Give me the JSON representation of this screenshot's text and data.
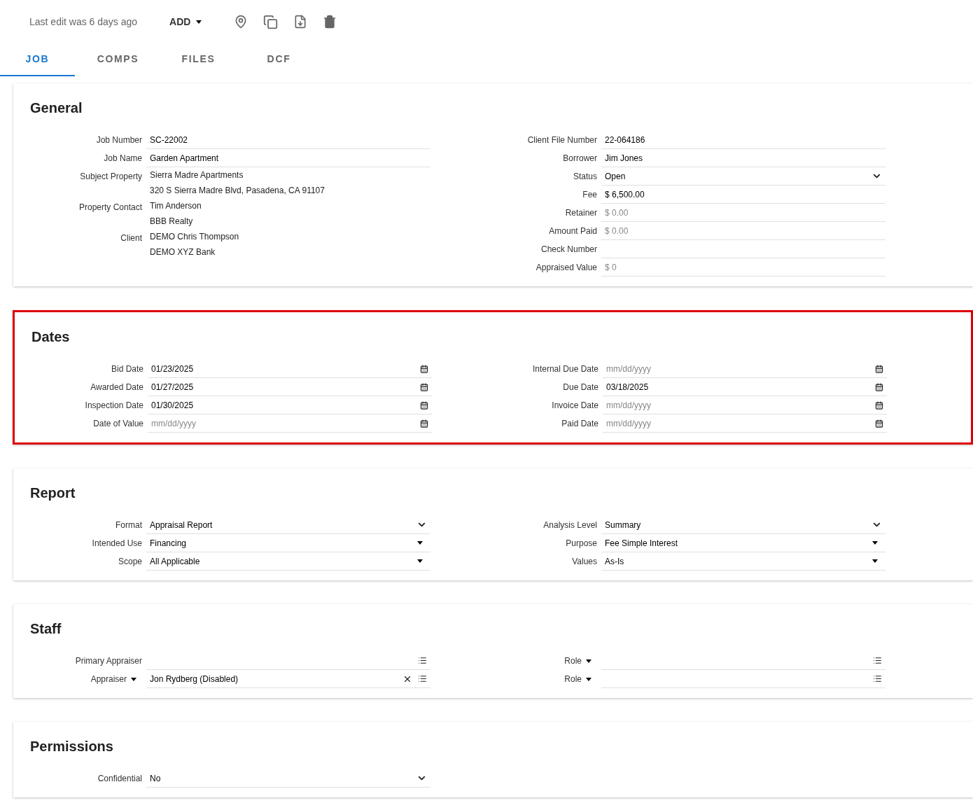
{
  "toolbar": {
    "last_edit": "Last edit was 6 days ago",
    "add_button": "ADD"
  },
  "tabs": [
    {
      "label": "JOB",
      "selected": true
    },
    {
      "label": "COMPS",
      "selected": false
    },
    {
      "label": "FILES",
      "selected": false
    },
    {
      "label": "DCF",
      "selected": false
    }
  ],
  "sections": [
    {
      "title": "General",
      "highlighted": false,
      "left": [
        {
          "label": "Job Number",
          "kind": "text",
          "value": "SC-22002"
        },
        {
          "label": "Job Name",
          "kind": "text",
          "value": "Garden Apartment"
        },
        {
          "label": "Subject Property",
          "kind": "plain",
          "lines": [
            "Sierra Madre Apartments",
            "320 S Sierra Madre Blvd, Pasadena, CA 91107"
          ]
        },
        {
          "label": "Property Contact",
          "kind": "plain",
          "lines": [
            "Tim Anderson",
            "BBB Realty"
          ]
        },
        {
          "label": "Client",
          "kind": "plain",
          "lines": [
            "DEMO Chris Thompson",
            "DEMO XYZ Bank"
          ]
        }
      ],
      "right": [
        {
          "label": "Client File Number",
          "kind": "text",
          "value": "22-064186"
        },
        {
          "label": "Borrower",
          "kind": "text",
          "value": "Jim Jones"
        },
        {
          "label": "Status",
          "kind": "select",
          "value": "Open"
        },
        {
          "label": "Fee",
          "kind": "text",
          "value": "$ 6,500.00"
        },
        {
          "label": "Retainer",
          "kind": "text",
          "placeholder": "$ 0.00"
        },
        {
          "label": "Amount Paid",
          "kind": "text",
          "placeholder": "$ 0.00"
        },
        {
          "label": "Check Number",
          "kind": "text"
        },
        {
          "label": "Appraised Value",
          "kind": "text",
          "placeholder": "$ 0"
        }
      ]
    },
    {
      "title": "Dates",
      "highlighted": true,
      "left": [
        {
          "label": "Bid Date",
          "kind": "date",
          "value": "01/23/2025"
        },
        {
          "label": "Awarded Date",
          "kind": "date",
          "value": "01/27/2025"
        },
        {
          "label": "Inspection Date",
          "kind": "date",
          "value": "01/30/2025"
        },
        {
          "label": "Date of Value",
          "kind": "date",
          "placeholder": "mm/dd/yyyy"
        }
      ],
      "right": [
        {
          "label": "Internal Due Date",
          "kind": "date",
          "placeholder": "mm/dd/yyyy"
        },
        {
          "label": "Due Date",
          "kind": "date",
          "value": "03/18/2025"
        },
        {
          "label": "Invoice Date",
          "kind": "date",
          "placeholder": "mm/dd/yyyy"
        },
        {
          "label": "Paid Date",
          "kind": "date",
          "placeholder": "mm/dd/yyyy"
        }
      ]
    },
    {
      "title": "Report",
      "highlighted": false,
      "left": [
        {
          "label": "Format",
          "kind": "select",
          "value": "Appraisal Report"
        },
        {
          "label": "Intended Use",
          "kind": "dropdown",
          "value": "Financing"
        },
        {
          "label": "Scope",
          "kind": "dropdown",
          "value": "All Applicable"
        }
      ],
      "right": [
        {
          "label": "Analysis Level",
          "kind": "select",
          "value": "Summary"
        },
        {
          "label": "Purpose",
          "kind": "dropdown",
          "value": "Fee Simple Interest"
        },
        {
          "label": "Values",
          "kind": "dropdown",
          "value": "As-Is"
        }
      ]
    },
    {
      "title": "Staff",
      "highlighted": false,
      "left": [
        {
          "label": "Primary Appraiser",
          "kind": "picker",
          "label_menu": false,
          "clearable": false
        },
        {
          "label": "Appraiser",
          "kind": "picker",
          "label_menu": true,
          "clearable": true,
          "value": "Jon Rydberg (Disabled)"
        }
      ],
      "right": [
        {
          "label": "Role",
          "kind": "picker",
          "label_menu": true,
          "clearable": false
        },
        {
          "label": "Role",
          "kind": "picker",
          "label_menu": true,
          "clearable": false
        }
      ]
    },
    {
      "title": "Permissions",
      "highlighted": false,
      "left": [
        {
          "label": "Confidential",
          "kind": "select",
          "value": "No"
        }
      ]
    }
  ]
}
